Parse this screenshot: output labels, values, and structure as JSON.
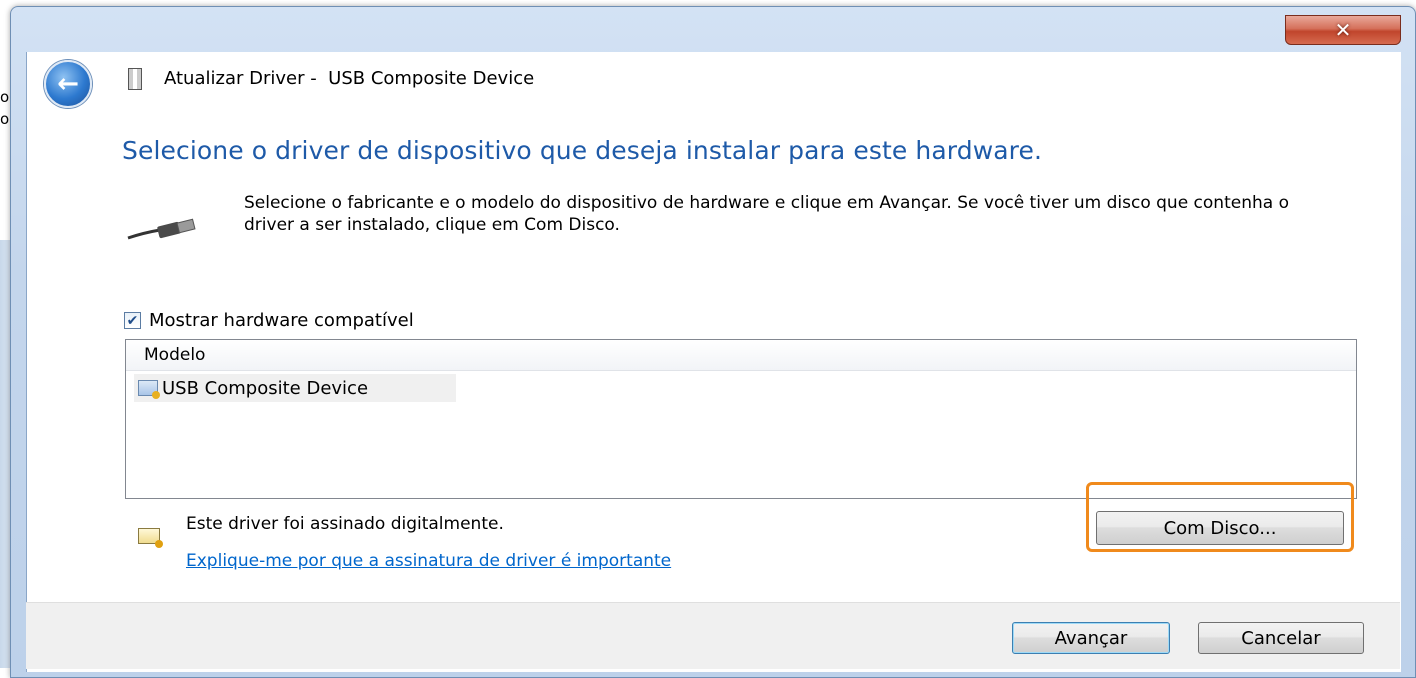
{
  "background": {
    "text_lines": [
      "or",
      "or"
    ]
  },
  "window": {
    "close_glyph": "✕"
  },
  "header": {
    "back_glyph": "←",
    "title": "Atualizar Driver -  USB Composite Device"
  },
  "main": {
    "heading": "Selecione o driver de dispositivo que deseja instalar para este hardware.",
    "description": "Selecione o fabricante e o modelo do dispositivo de hardware e clique em Avançar. Se você tiver um disco que contenha o driver a ser instalado, clique em Com Disco.",
    "show_compatible": {
      "label": "Mostrar hardware compatível",
      "checked": true,
      "check_glyph": "✔"
    },
    "list": {
      "column_header": "Modelo",
      "items": [
        "USB Composite Device"
      ]
    },
    "signed_text": "Este driver foi assinado digitalmente.",
    "help_link": "Explique-me por que a assinatura de driver é importante",
    "have_disk_button": "Com Disco..."
  },
  "footer": {
    "next_button": "Avançar",
    "cancel_button": "Cancelar"
  },
  "colors": {
    "heading": "#1e5aa8",
    "link": "#0066cc",
    "highlight": "#f08a1c"
  },
  "icons": [
    "back-arrow-icon",
    "device-icon",
    "usb-cable-icon",
    "certificate-icon",
    "close-icon"
  ]
}
